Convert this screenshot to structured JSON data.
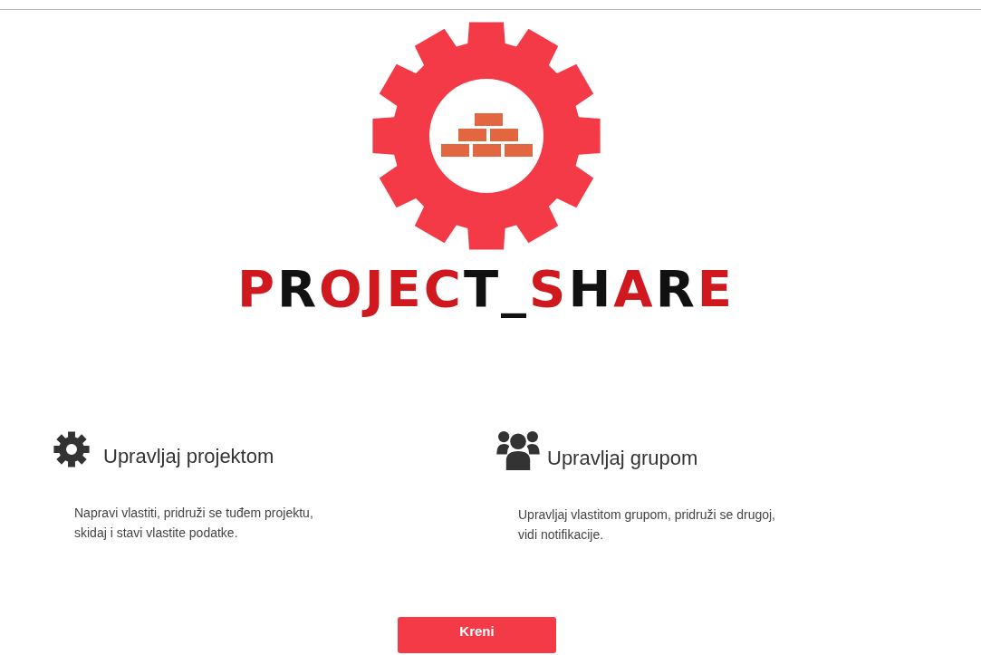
{
  "logo": {
    "segments": [
      {
        "text": "P",
        "color": "#d0181f"
      },
      {
        "text": "R",
        "color": "#111111"
      },
      {
        "text": "OJEC",
        "color": "#d0181f"
      },
      {
        "text": "T_",
        "color": "#111111"
      },
      {
        "text": "S",
        "color": "#d0181f"
      },
      {
        "text": "H",
        "color": "#111111"
      },
      {
        "text": "A",
        "color": "#d0181f"
      },
      {
        "text": "R",
        "color": "#111111"
      },
      {
        "text": "E",
        "color": "#d0181f"
      }
    ]
  },
  "features": [
    {
      "kind": "gear",
      "title": "Upravljaj projektom",
      "text": "Napravi vlastiti, pridruži se tuđem projektu, skidaj i stavi vlastite podatke."
    },
    {
      "kind": "group",
      "title": "Upravljaj grupom",
      "text": "Upravljaj vlastitom grupom, pridruži se drugoj, vidi notifikacije."
    }
  ],
  "button": {
    "label": "Kreni"
  }
}
